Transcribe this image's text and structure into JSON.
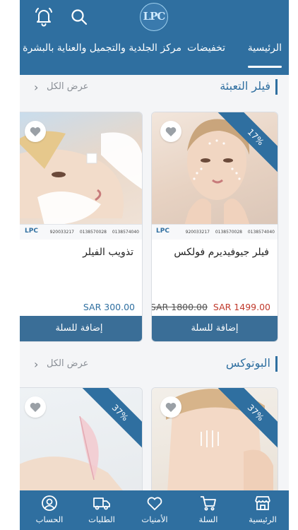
{
  "header": {
    "logo_text": "LPC",
    "tabs": [
      {
        "label": "الرئيسية",
        "active": true
      },
      {
        "label": "تخفيضات",
        "active": false
      },
      {
        "label": "مركز الجلدية والتجميل والعناية بالبشرة",
        "active": false
      }
    ],
    "icons": {
      "bell": "bell-icon",
      "search": "search-icon"
    }
  },
  "sections": [
    {
      "title": "فيلر التعبئة",
      "view_all": "عرض الكل",
      "products": [
        {
          "name": "فيلر جيوفيديرم فولكس",
          "badge": "17%",
          "price_old": "SAR 1800.00",
          "price_new": "SAR 1499.00",
          "add_label": "إضافة للسلة",
          "brand_phones": [
            "0138574040",
            "0138570028",
            "920033217"
          ]
        },
        {
          "name": "تذويب الفيلر",
          "badge": "",
          "price": "SAR 300.00",
          "add_label": "إضافة للسلة",
          "brand_phones": [
            "0138574040",
            "0138570028",
            "920033217"
          ]
        }
      ]
    },
    {
      "title": "البوتوكس",
      "view_all": "عرض الكل",
      "products": [
        {
          "badge": "37%"
        },
        {
          "badge": "37%"
        }
      ]
    }
  ],
  "bottom_nav": [
    {
      "label": "الرئيسية",
      "icon": "store-icon"
    },
    {
      "label": "السلة",
      "icon": "cart-icon"
    },
    {
      "label": "الأمنيات",
      "icon": "heart-icon"
    },
    {
      "label": "الطلبات",
      "icon": "truck-icon"
    },
    {
      "label": "الحساب",
      "icon": "user-icon"
    }
  ],
  "colors": {
    "primary": "#2f6fa0",
    "button": "#3a6e97",
    "sale_price": "#c0392b",
    "background": "#f4f5f7"
  }
}
